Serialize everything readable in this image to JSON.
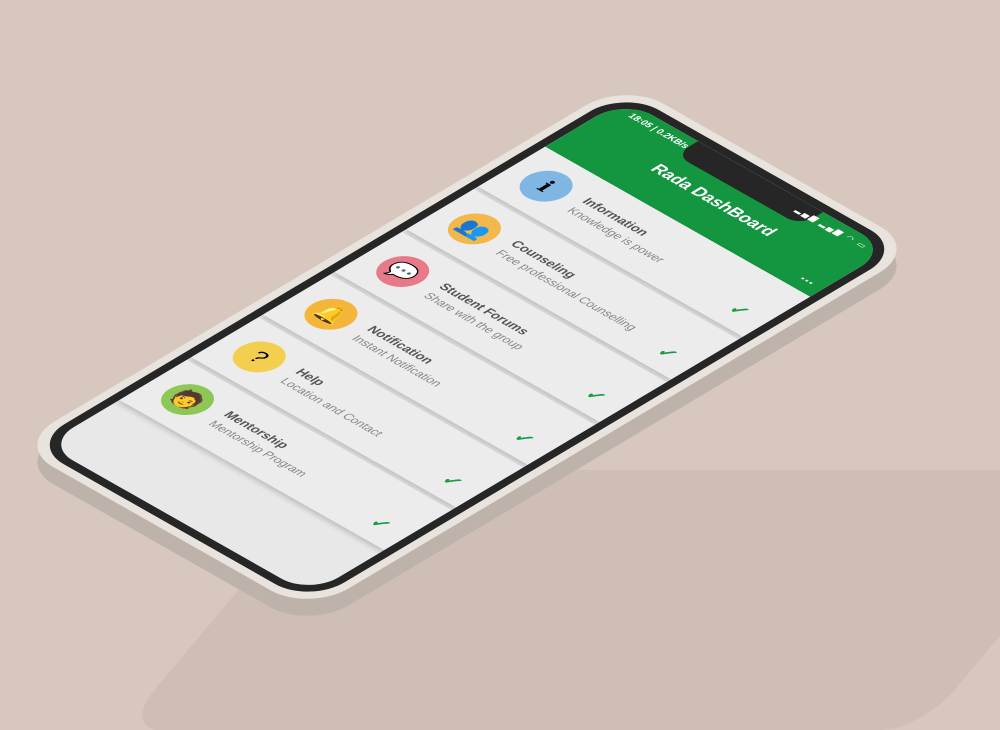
{
  "status_bar": {
    "time": "18:05 | 0.2KB/s",
    "icons": "▂▄▆ ▂▄▆ ◠ ▭"
  },
  "header": {
    "title": "Rada DashBoard",
    "menu": "⋮"
  },
  "items": [
    {
      "title": "Information",
      "subtitle": "Knowledge is power",
      "icon": "ℹ",
      "color": "#7fb6e3"
    },
    {
      "title": "Counseling",
      "subtitle": "Free professional Counselling",
      "icon": "👥",
      "color": "#f2b84b"
    },
    {
      "title": "Student Forums",
      "subtitle": "Share with the group",
      "icon": "💬",
      "color": "#e77a8a"
    },
    {
      "title": "Notification",
      "subtitle": "Instant Notification",
      "icon": "🔔",
      "color": "#f3b63a"
    },
    {
      "title": "Help",
      "subtitle": "Location and Contact",
      "icon": "?",
      "color": "#f2cf4f"
    },
    {
      "title": "Mentorship",
      "subtitle": "Mentorship Program",
      "icon": "🧑",
      "color": "#8fc757"
    }
  ],
  "check": "✓"
}
